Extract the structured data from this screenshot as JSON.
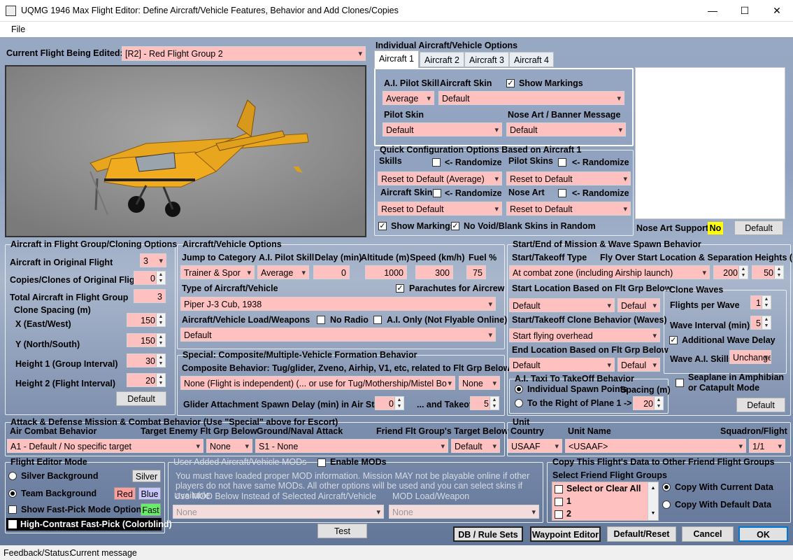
{
  "window": {
    "title": "UQMG 1946 Max Flight Editor:  Define Aircraft/Vehicle Features, Behavior and Add Clones/Copies",
    "minimize": "—",
    "maximize": "☐",
    "close": "✕"
  },
  "menu": {
    "file": "File"
  },
  "current": {
    "label": "Current Flight Being Edited:",
    "value": "[R2] -  Red Flight Group  2"
  },
  "individual": {
    "title": "Individual Aircraft/Vehicle Options",
    "tabs": [
      "Aircraft 1",
      "Aircraft 2",
      "Aircraft 3",
      "Aircraft 4"
    ],
    "ai_skill_label": "A.I. Pilot Skill",
    "ai_skill": "Average",
    "skin_label": "Aircraft Skin",
    "skin": "Default",
    "show_markings": "Show Markings",
    "pilot_skin_label": "Pilot Skin",
    "pilot_skin": "Default",
    "nose_label": "Nose Art / Banner Message",
    "nose": "Default"
  },
  "quick": {
    "title": "Quick Configuration Options Based on Aircraft 1",
    "skills": "Skills",
    "randomize": "<- Randomize",
    "skills_value": "Reset to Default (Average)",
    "pilot_skins": "Pilot Skins",
    "pilot_skins_value": "Reset to Default",
    "aircraft_skins": "Aircraft Skins",
    "aircraft_skins_value": "Reset to Default",
    "nose_art": "Nose Art",
    "nose_art_value": "Reset to Default",
    "show_markings": "Show Markings",
    "no_void": "No Void/Blank Skins in Random"
  },
  "nose_support": {
    "label": "Nose Art Support:",
    "value": "No",
    "button": "Default"
  },
  "cloning": {
    "title": "Aircraft in Flight Group/Cloning Options",
    "orig_label": "Aircraft in Original Flight",
    "orig": "3",
    "copies_label": "Copies/Clones of Original Flight",
    "copies": "0",
    "total_label": "Total Aircraft in Flight Group",
    "total": "3",
    "spacing": "Clone Spacing (m)",
    "x_label": "X (East/West)",
    "x": "150",
    "y_label": "Y (North/South)",
    "y": "150",
    "h1_label": "Height 1 (Group Interval)",
    "h1": "30",
    "h2_label": "Height 2 (Flight Interval)",
    "h2": "20",
    "default": "Default"
  },
  "aircraft": {
    "title": "Aircraft/Vehicle Options",
    "jump_label": "Jump to Category",
    "jump": "Trainer & Spor",
    "skill_label": "A.I. Pilot Skill",
    "skill": "Average",
    "delay_label": "Delay (min)",
    "delay": "0",
    "alt_label": "Altitude (m)",
    "alt": "1000",
    "speed_label": "Speed (km/h)",
    "speed": "300",
    "fuel_label": "Fuel %",
    "fuel": "75",
    "type_label": "Type of Aircraft/Vehicle",
    "parachutes": "Parachutes for Aircrew",
    "type": "Piper J-3 Cub, 1938",
    "load_label": "Aircraft/Vehicle Load/Weapons",
    "no_radio": "No Radio",
    "ai_only": "A.I. Only (Not Flyable Online)",
    "load": "Default"
  },
  "special": {
    "title": "Special: Composite/Multiple-Vehicle Formation Behavior",
    "composite_label": "Composite Behavior: Tug/glider, Zveno, Airhip, V1, etc, related to Flt Grp Below",
    "composite": "None (Flight is independent) (... or use for Tug/Mothership/Mistel Bo",
    "composite2": "None",
    "glider_label": "Glider Attachment Spawn Delay (min) in Air Start",
    "glider": "0",
    "takeoff_label": "... and Takeoff",
    "takeoff": "5"
  },
  "spawn": {
    "title": "Start/End of Mission & Wave Spawn Behavior",
    "type_label": "Start/Takeoff Type",
    "fly_label": "Fly Over Start Location & Separation Heights (m)",
    "type": "At combat zone (including Airship launch)",
    "h1": "200",
    "h2": "50",
    "start_loc_label": "Start Location Based on Flt Grp Below",
    "start_loc": "Default",
    "start_loc2": "Defaul",
    "clone_label": "Start/Takeoff Clone Behavior (Waves)",
    "clone": "Start flying overhead",
    "end_label": "End Location Based on Flt Grp Below",
    "end": "Default",
    "end2": "Defaul",
    "taxi_label": "A.I. Taxi To TakeOff Behavior",
    "indiv": "Individual Spawn Points",
    "spacing_label": "Spacing (m)",
    "right": "To the Right of Plane 1 ->",
    "right_val": "20",
    "waves_title": "Clone Waves",
    "fpw_label": "Flights per Wave",
    "fpw": "1",
    "interval_label": "Wave Interval (min)",
    "interval": "5",
    "add_delay": "Additional Wave Delay",
    "skills_label": "Wave A.I. Skills",
    "skills": "Unchange",
    "seaplane": "Seaplane in Amphibian\nor Catapult Mode",
    "default": "Default"
  },
  "attack": {
    "title": "Attack & Defense Mission & Combat Behavior (Use \"Special\" above for Escort)",
    "air_label": "Air Combat Behavior",
    "enemy_label": "Target Enemy Flt Grp Below",
    "ground_label": "Ground/Naval Attack",
    "friend_label": "Friend Flt Group's Target Below",
    "air": "A1 - Default / No specific target",
    "enemy": "None",
    "ground": "S1 - None",
    "friend": "Default"
  },
  "unit": {
    "title": "Unit",
    "country_label": "Country",
    "name_label": "Unit Name",
    "squad_label": "Squadron/Flight",
    "country": "USAAF",
    "name": "<USAAF>",
    "squad": "1/1"
  },
  "mode": {
    "title": "Flight Editor Mode",
    "silver": "Silver Background",
    "silver_btn": "Silver",
    "team": "Team Background",
    "red": "Red",
    "blue": "Blue",
    "fast": "Show Fast-Pick Mode Options",
    "fast_btn": "Fast",
    "contrast": "High-Contrast Fast-Pick (Colorblind)"
  },
  "mods": {
    "title": "User Added Aircraft/Vehicle MODs",
    "enable": "Enable MODs",
    "msg": "You must have loaded proper MOD information. Mission MAY not be playable online if other players do not have same MODs.  All other options will be used and you can select skins if available.",
    "use_label": "Use MOD Below Instead of Selected Aircraft/Vehicle",
    "load_label": "MOD Load/Weapon",
    "mod": "None",
    "mod_load": "None"
  },
  "copy": {
    "title": "Copy This Flight's Data to Other Friend Flight Groups",
    "select_label": "Select Friend Flight Groups",
    "items": [
      "Select or Clear All",
      "1",
      "2"
    ],
    "current": "Copy With Current Data",
    "default": "Copy With Default Data"
  },
  "buttons": {
    "test": "Test",
    "db": "DB / Rule Sets",
    "waypoint": "Waypoint Editor",
    "reset": "Default/Reset",
    "cancel": "Cancel",
    "ok": "OK"
  },
  "status": {
    "label": "Feedback/Status:",
    "value": "Current message"
  },
  "colors": {
    "field": "#ffc0c0",
    "plane": "#e6a21c",
    "red": "#ff9c9c",
    "blue": "#c8c8ff",
    "fast": "#66ee66"
  }
}
